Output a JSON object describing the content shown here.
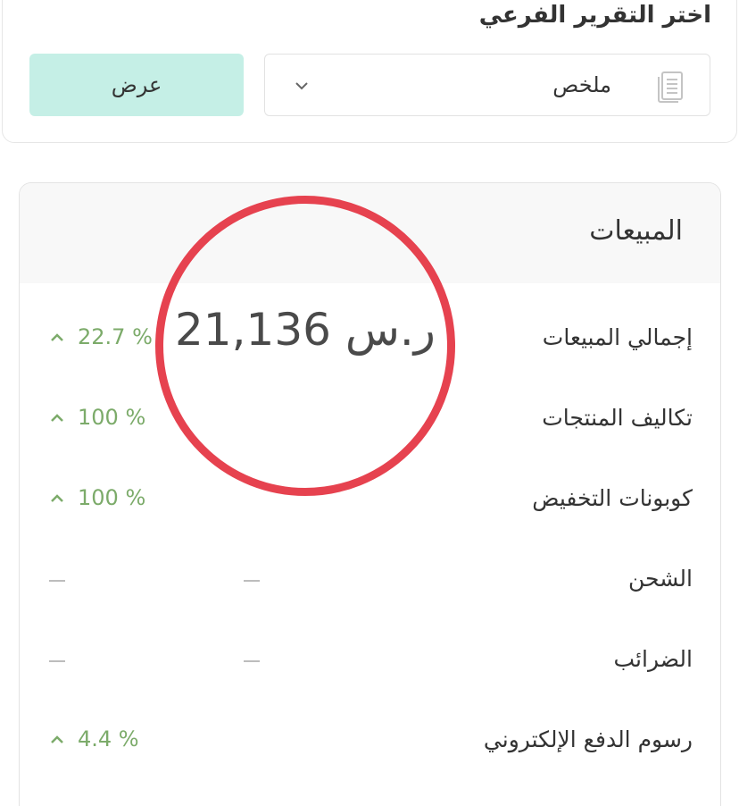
{
  "subreport": {
    "title": "اختر التقرير الفرعي",
    "selected_value": "ملخص",
    "show_button_label": "عرض"
  },
  "sales": {
    "title": "المبيعات",
    "total_value": "21,136 ر.س",
    "rows": [
      {
        "label": "إجمالي المبيعات",
        "change": "22.7 %",
        "trend": "up"
      },
      {
        "label": "تكاليف المنتجات",
        "change": "100 %",
        "trend": "up"
      },
      {
        "label": "كوبونات التخفيض",
        "change": "100 %",
        "trend": "up"
      },
      {
        "label": "الشحن",
        "change": "—",
        "value": "—"
      },
      {
        "label": "الضرائب",
        "change": "—",
        "value": "—"
      },
      {
        "label": "رسوم الدفع الإلكتروني",
        "change": "4.4 %",
        "trend": "up"
      }
    ]
  },
  "colors": {
    "accent_button": "#c5efe6",
    "positive_change": "#7cab6a",
    "annotation": "#e6424f"
  },
  "icons": {
    "select_icon": "document-icon",
    "dropdown": "chevron-down-icon",
    "trend": "caret-up-icon"
  }
}
